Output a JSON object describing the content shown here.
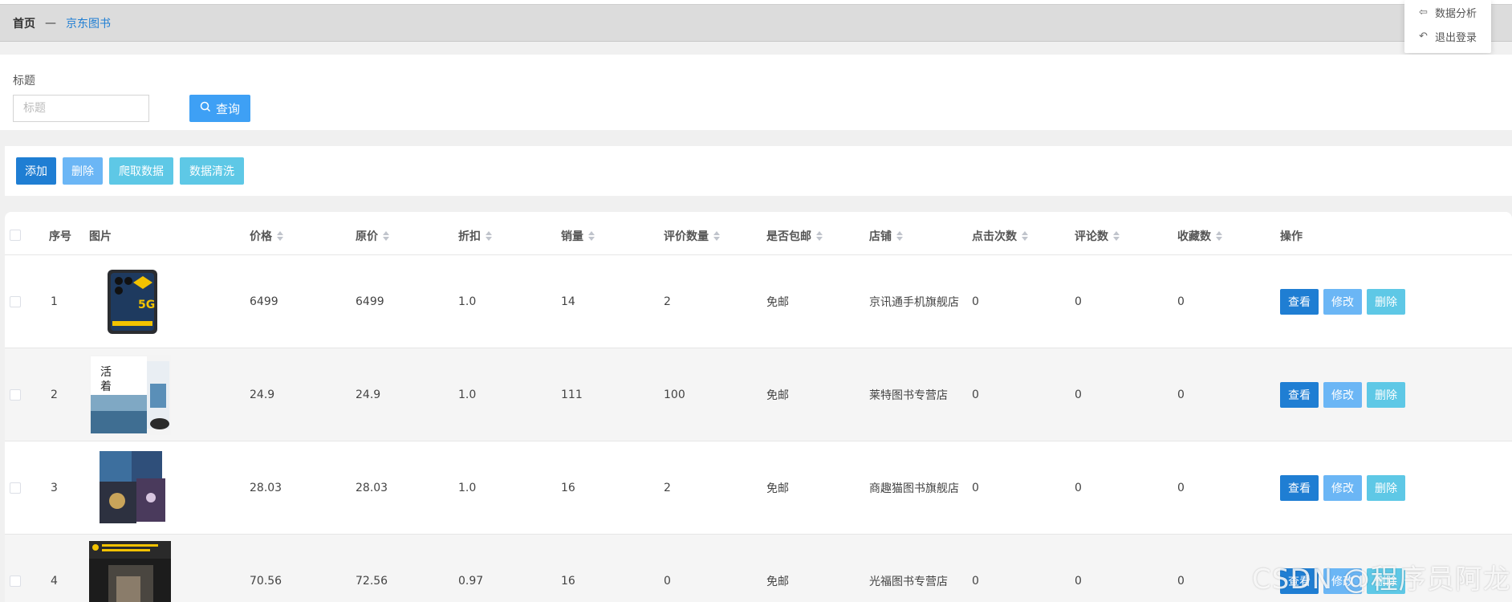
{
  "breadcrumb": {
    "home": "首页",
    "separator": "—",
    "current": "京东图书"
  },
  "dropdown": {
    "items": [
      {
        "icon": "arrow-left-icon",
        "label": "数据分析"
      },
      {
        "icon": "undo-icon",
        "label": "退出登录"
      }
    ]
  },
  "search": {
    "label": "标题",
    "placeholder": "标题",
    "value": "",
    "button": "查询",
    "button_icon": "search-icon"
  },
  "actions": {
    "add": "添加",
    "delete": "删除",
    "crawl": "爬取数据",
    "clean": "数据清洗"
  },
  "table": {
    "columns": [
      "序号",
      "图片",
      "价格",
      "原价",
      "折扣",
      "销量",
      "评价数量",
      "是否包邮",
      "店铺",
      "点击次数",
      "评论数",
      "收藏数",
      "操作"
    ],
    "sortable": [
      false,
      false,
      true,
      true,
      true,
      true,
      true,
      true,
      true,
      true,
      true,
      true,
      false
    ],
    "row_buttons": {
      "view": "查看",
      "edit": "修改",
      "delete": "删除"
    },
    "rows": [
      {
        "index": "1",
        "price": "6499",
        "original": "6499",
        "discount": "1.0",
        "sales": "14",
        "reviews": "2",
        "free_shipping": "免邮",
        "shop": "京讯通手机旗舰店",
        "clicks": "0",
        "comments": "0",
        "favorites": "0"
      },
      {
        "index": "2",
        "price": "24.9",
        "original": "24.9",
        "discount": "1.0",
        "sales": "111",
        "reviews": "100",
        "free_shipping": "免邮",
        "shop": "莱特图书专营店",
        "clicks": "0",
        "comments": "0",
        "favorites": "0"
      },
      {
        "index": "3",
        "price": "28.03",
        "original": "28.03",
        "discount": "1.0",
        "sales": "16",
        "reviews": "2",
        "free_shipping": "免邮",
        "shop": "商趣猫图书旗舰店",
        "clicks": "0",
        "comments": "0",
        "favorites": "0"
      },
      {
        "index": "4",
        "price": "70.56",
        "original": "72.56",
        "discount": "0.97",
        "sales": "16",
        "reviews": "0",
        "free_shipping": "免邮",
        "shop": "光福图书专营店",
        "clicks": "0",
        "comments": "0",
        "favorites": "0"
      }
    ]
  },
  "watermark": "CSDN @程序员阿龙",
  "colors": {
    "primary": "#1f7ed3",
    "light_blue": "#6bb6f5",
    "cyan": "#5ec8e6",
    "query": "#3ea0f5"
  }
}
